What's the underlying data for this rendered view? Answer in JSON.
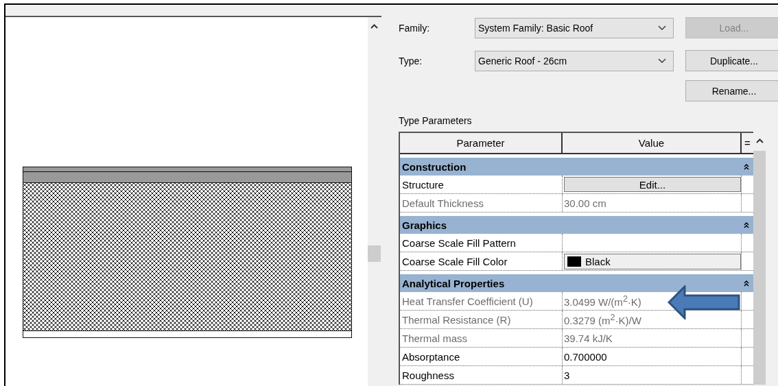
{
  "family": {
    "label": "Family:",
    "value": "System Family: Basic Roof"
  },
  "type": {
    "label": "Type:",
    "value": "Generic Roof - 26cm"
  },
  "buttons": [
    {
      "label": "Load...",
      "disabled": true
    },
    {
      "label": "Duplicate...",
      "disabled": false
    },
    {
      "label": "Rename...",
      "disabled": false
    }
  ],
  "type_parameters": {
    "title": "Type Parameters",
    "columns": [
      "Parameter",
      "Value",
      "="
    ],
    "groups": [
      {
        "name": "Construction",
        "expanded": true,
        "rows": [
          {
            "parameter": "Structure",
            "kind": "button",
            "value": "Edit...",
            "disabled": false
          },
          {
            "parameter": "Default Thickness",
            "kind": "text",
            "value": "30.00 cm",
            "disabled": true
          }
        ]
      },
      {
        "name": "Graphics",
        "expanded": true,
        "rows": [
          {
            "parameter": "Coarse Scale Fill Pattern",
            "kind": "text",
            "disabled": false
          },
          {
            "parameter": "Coarse Scale Fill Color",
            "kind": "color",
            "value": "Black",
            "color": "#000000",
            "disabled": false
          }
        ]
      },
      {
        "name": "Analytical Properties",
        "expanded": true,
        "rows": [
          {
            "parameter": "Heat Transfer Coefficient (U)",
            "kind": "text",
            "value": "3.0499 W/(m$^{2}$·K)",
            "disabled": true
          },
          {
            "parameter": "Thermal Resistance (R)",
            "kind": "text",
            "value": "0.3279 (m$^{2}$·K)/W",
            "disabled": true
          },
          {
            "parameter": "Thermal mass",
            "kind": "text",
            "value": "39.74 kJ/K",
            "disabled": true
          },
          {
            "parameter": "Absorptance",
            "kind": "text",
            "value": "0.700000",
            "disabled": false
          },
          {
            "parameter": "Roughness",
            "kind": "text",
            "value": "3",
            "disabled": false
          }
        ]
      }
    ]
  }
}
